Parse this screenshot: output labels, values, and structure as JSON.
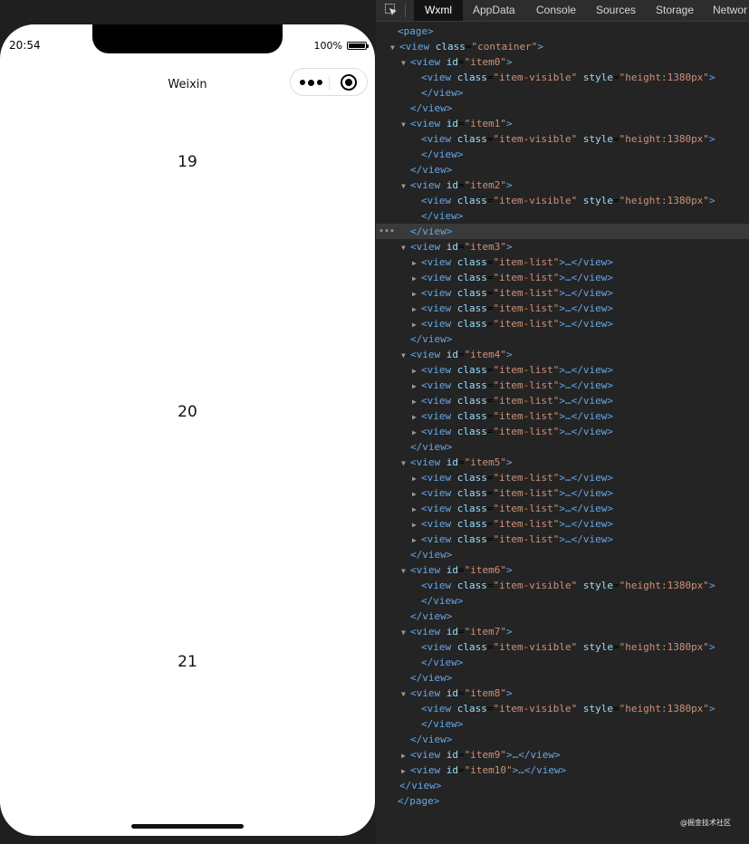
{
  "simulator": {
    "time": "20:54",
    "battery_pct": "100%",
    "nav_title": "Weixin",
    "page_numbers": [
      "19",
      "20",
      "21"
    ]
  },
  "devtools": {
    "tabs": [
      "Wxml",
      "AppData",
      "Console",
      "Sources",
      "Storage",
      "Networ"
    ],
    "active_tab": "Wxml",
    "watermark": "@掘金技术社区",
    "tree": [
      {
        "indent": 0,
        "tri": "",
        "open": "<page>"
      },
      {
        "indent": 1,
        "tri": "▼",
        "open": "<view",
        "attr": "class",
        "val": "\"container\"",
        "close": ">"
      },
      {
        "indent": 2,
        "tri": "▼",
        "open": "<view",
        "attr": "id",
        "val": "\"item0\"",
        "close": ">"
      },
      {
        "indent": 3,
        "tri": "",
        "open": "<view",
        "attr": "class",
        "val": "\"item-visible\"",
        "attr2": "style",
        "val2": "\"height:1380px\"",
        "close": ">"
      },
      {
        "indent": 3,
        "tri": "",
        "open": "</view>"
      },
      {
        "indent": 2,
        "tri": "",
        "open": "</view>"
      },
      {
        "indent": 2,
        "tri": "▼",
        "open": "<view",
        "attr": "id",
        "val": "\"item1\"",
        "close": ">"
      },
      {
        "indent": 3,
        "tri": "",
        "open": "<view",
        "attr": "class",
        "val": "\"item-visible\"",
        "attr2": "style",
        "val2": "\"height:1380px\"",
        "close": ">"
      },
      {
        "indent": 3,
        "tri": "",
        "open": "</view>"
      },
      {
        "indent": 2,
        "tri": "",
        "open": "</view>"
      },
      {
        "indent": 2,
        "tri": "▼",
        "open": "<view",
        "attr": "id",
        "val": "\"item2\"",
        "close": ">"
      },
      {
        "indent": 3,
        "tri": "",
        "open": "<view",
        "attr": "class",
        "val": "\"item-visible\"",
        "attr2": "style",
        "val2": "\"height:1380px\"",
        "close": ">"
      },
      {
        "indent": 3,
        "tri": "",
        "open": "</view>"
      },
      {
        "indent": 2,
        "tri": "",
        "open": "</view>",
        "hl": true
      },
      {
        "indent": 2,
        "tri": "▼",
        "open": "<view",
        "attr": "id",
        "val": "\"item3\"",
        "close": ">"
      },
      {
        "indent": 3,
        "tri": "▶",
        "open": "<view",
        "attr": "class",
        "val": "\"item-list\"",
        "close": ">…</view>"
      },
      {
        "indent": 3,
        "tri": "▶",
        "open": "<view",
        "attr": "class",
        "val": "\"item-list\"",
        "close": ">…</view>"
      },
      {
        "indent": 3,
        "tri": "▶",
        "open": "<view",
        "attr": "class",
        "val": "\"item-list\"",
        "close": ">…</view>"
      },
      {
        "indent": 3,
        "tri": "▶",
        "open": "<view",
        "attr": "class",
        "val": "\"item-list\"",
        "close": ">…</view>"
      },
      {
        "indent": 3,
        "tri": "▶",
        "open": "<view",
        "attr": "class",
        "val": "\"item-list\"",
        "close": ">…</view>"
      },
      {
        "indent": 2,
        "tri": "",
        "open": "</view>"
      },
      {
        "indent": 2,
        "tri": "▼",
        "open": "<view",
        "attr": "id",
        "val": "\"item4\"",
        "close": ">"
      },
      {
        "indent": 3,
        "tri": "▶",
        "open": "<view",
        "attr": "class",
        "val": "\"item-list\"",
        "close": ">…</view>"
      },
      {
        "indent": 3,
        "tri": "▶",
        "open": "<view",
        "attr": "class",
        "val": "\"item-list\"",
        "close": ">…</view>"
      },
      {
        "indent": 3,
        "tri": "▶",
        "open": "<view",
        "attr": "class",
        "val": "\"item-list\"",
        "close": ">…</view>"
      },
      {
        "indent": 3,
        "tri": "▶",
        "open": "<view",
        "attr": "class",
        "val": "\"item-list\"",
        "close": ">…</view>"
      },
      {
        "indent": 3,
        "tri": "▶",
        "open": "<view",
        "attr": "class",
        "val": "\"item-list\"",
        "close": ">…</view>"
      },
      {
        "indent": 2,
        "tri": "",
        "open": "</view>"
      },
      {
        "indent": 2,
        "tri": "▼",
        "open": "<view",
        "attr": "id",
        "val": "\"item5\"",
        "close": ">"
      },
      {
        "indent": 3,
        "tri": "▶",
        "open": "<view",
        "attr": "class",
        "val": "\"item-list\"",
        "close": ">…</view>"
      },
      {
        "indent": 3,
        "tri": "▶",
        "open": "<view",
        "attr": "class",
        "val": "\"item-list\"",
        "close": ">…</view>"
      },
      {
        "indent": 3,
        "tri": "▶",
        "open": "<view",
        "attr": "class",
        "val": "\"item-list\"",
        "close": ">…</view>"
      },
      {
        "indent": 3,
        "tri": "▶",
        "open": "<view",
        "attr": "class",
        "val": "\"item-list\"",
        "close": ">…</view>"
      },
      {
        "indent": 3,
        "tri": "▶",
        "open": "<view",
        "attr": "class",
        "val": "\"item-list\"",
        "close": ">…</view>"
      },
      {
        "indent": 2,
        "tri": "",
        "open": "</view>"
      },
      {
        "indent": 2,
        "tri": "▼",
        "open": "<view",
        "attr": "id",
        "val": "\"item6\"",
        "close": ">"
      },
      {
        "indent": 3,
        "tri": "",
        "open": "<view",
        "attr": "class",
        "val": "\"item-visible\"",
        "attr2": "style",
        "val2": "\"height:1380px\"",
        "close": ">"
      },
      {
        "indent": 3,
        "tri": "",
        "open": "</view>"
      },
      {
        "indent": 2,
        "tri": "",
        "open": "</view>"
      },
      {
        "indent": 2,
        "tri": "▼",
        "open": "<view",
        "attr": "id",
        "val": "\"item7\"",
        "close": ">"
      },
      {
        "indent": 3,
        "tri": "",
        "open": "<view",
        "attr": "class",
        "val": "\"item-visible\"",
        "attr2": "style",
        "val2": "\"height:1380px\"",
        "close": ">"
      },
      {
        "indent": 3,
        "tri": "",
        "open": "</view>"
      },
      {
        "indent": 2,
        "tri": "",
        "open": "</view>"
      },
      {
        "indent": 2,
        "tri": "▼",
        "open": "<view",
        "attr": "id",
        "val": "\"item8\"",
        "close": ">"
      },
      {
        "indent": 3,
        "tri": "",
        "open": "<view",
        "attr": "class",
        "val": "\"item-visible\"",
        "attr2": "style",
        "val2": "\"height:1380px\"",
        "close": ">"
      },
      {
        "indent": 3,
        "tri": "",
        "open": "</view>"
      },
      {
        "indent": 2,
        "tri": "",
        "open": "</view>"
      },
      {
        "indent": 2,
        "tri": "▶",
        "open": "<view",
        "attr": "id",
        "val": "\"item9\"",
        "close": ">…</view>"
      },
      {
        "indent": 2,
        "tri": "▶",
        "open": "<view",
        "attr": "id",
        "val": "\"item10\"",
        "close": ">…</view>"
      },
      {
        "indent": 1,
        "tri": "",
        "open": "</view>"
      },
      {
        "indent": 0,
        "tri": "",
        "open": "</page>"
      }
    ]
  }
}
